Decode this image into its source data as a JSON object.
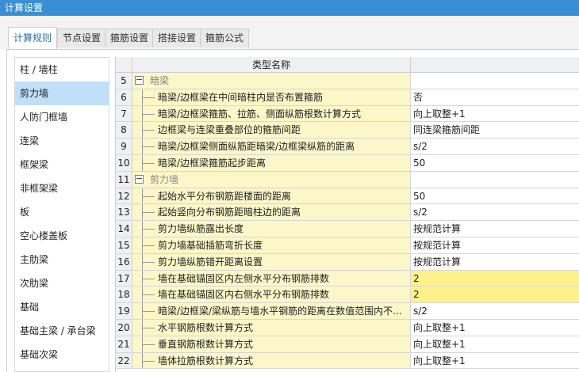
{
  "window": {
    "title": "计算设置"
  },
  "tabs": [
    "计算规则",
    "节点设置",
    "箍筋设置",
    "搭接设置",
    "箍筋公式"
  ],
  "sidebar": {
    "items": [
      "柱 / 墙柱",
      "剪力墙",
      "人防门框墙",
      "连梁",
      "框架梁",
      "非框架梁",
      "板",
      "空心楼盖板",
      "主肋梁",
      "次肋梁",
      "基础",
      "基础主梁 / 承台梁",
      "基础次梁"
    ],
    "active": "剪力墙"
  },
  "grid": {
    "header": "类型名称",
    "rows": [
      {
        "num": "5",
        "group": true,
        "toggle": "−",
        "name": "暗梁",
        "value": ""
      },
      {
        "num": "6",
        "name": "暗梁/边框梁在中间暗柱内是否布置箍筋",
        "value": "否"
      },
      {
        "num": "7",
        "name": "暗梁/边框梁箍筋、拉筋、侧面纵筋根数计算方式",
        "value": "向上取整+1"
      },
      {
        "num": "8",
        "name": "边框梁与连梁重叠部位的箍筋间距",
        "value": "同连梁箍筋间距"
      },
      {
        "num": "9",
        "name": "暗梁/边框梁侧面纵筋距暗梁/边框梁纵筋的距离",
        "value": "s/2"
      },
      {
        "num": "10",
        "name": "暗梁/边框梁箍筋起步距离",
        "value": "50"
      },
      {
        "num": "11",
        "group": true,
        "toggle": "−",
        "name": "剪力墙",
        "value": ""
      },
      {
        "num": "12",
        "name": "起始水平分布钢筋距楼面的距离",
        "value": "50"
      },
      {
        "num": "13",
        "name": "起始竖向分布钢筋距暗柱边的距离",
        "value": "s/2"
      },
      {
        "num": "14",
        "name": "剪力墙纵筋露出长度",
        "value": "按规范计算"
      },
      {
        "num": "15",
        "name": "剪力墙基础插筋弯折长度",
        "value": "按规范计算"
      },
      {
        "num": "16",
        "name": "剪力墙纵筋错开距离设置",
        "value": "按规范计算"
      },
      {
        "num": "17",
        "name": "墙在基础锚固区内左侧水平分布钢筋排数",
        "value": "2",
        "highlight": true
      },
      {
        "num": "18",
        "name": "墙在基础锚固区内右侧水平分布钢筋排数",
        "value": "2",
        "highlight": true
      },
      {
        "num": "19",
        "name": "暗梁/边框梁/梁纵筋与墙水平钢筋的距离在数值范围内不...",
        "value": "s/2"
      },
      {
        "num": "20",
        "name": "水平钢筋根数计算方式",
        "value": "向上取整+1"
      },
      {
        "num": "21",
        "name": "垂直钢筋根数计算方式",
        "value": "向上取整+1"
      },
      {
        "num": "22",
        "name": "墙体拉筋根数计算方式",
        "value": "向上取整+1"
      }
    ]
  },
  "colors": {
    "titlebar": "#3a8fd4",
    "active_tab_text": "#2a6fb0",
    "sidebar_active": "#bfe0f8",
    "name_cell": "#fbf7c8",
    "value_highlight": "#fdf28a"
  }
}
